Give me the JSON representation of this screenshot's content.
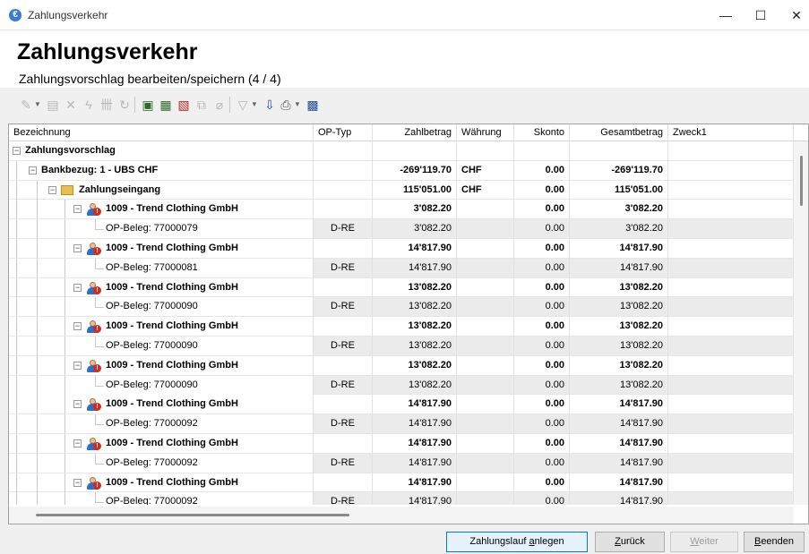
{
  "window": {
    "title": "Zahlungsverkehr",
    "minimize": "—",
    "maximize": "☐",
    "close": "✕"
  },
  "header": {
    "title": "Zahlungsverkehr",
    "subtitle": "Zahlungsvorschlag bearbeiten/speichern (4 / 4)"
  },
  "columns": [
    "Bezeichnung",
    "OP-Typ",
    "Zahlbetrag",
    "Währung",
    "Skonto",
    "Gesamtbetrag",
    "Zweck1"
  ],
  "rows": [
    {
      "name": "Zahlungsvorschlag",
      "type": "",
      "amount": "",
      "currency": "",
      "discount": "",
      "total": "",
      "purpose": ""
    },
    {
      "name": "Bankbezug: 1 - UBS CHF",
      "type": "",
      "amount": "-269'119.70",
      "currency": "CHF",
      "discount": "0.00",
      "total": "-269'119.70",
      "purpose": ""
    },
    {
      "name": "Zahlungseingang",
      "type": "",
      "amount": "115'051.00",
      "currency": "CHF",
      "discount": "0.00",
      "total": "115'051.00",
      "purpose": ""
    },
    {
      "name": "1009 - Trend Clothing GmbH",
      "type": "",
      "amount": "3'082.20",
      "currency": "",
      "discount": "0.00",
      "total": "3'082.20",
      "purpose": ""
    },
    {
      "name": "OP-Beleg: 77000079",
      "type": "D-RE",
      "amount": "3'082.20",
      "currency": "",
      "discount": "0.00",
      "total": "3'082.20",
      "purpose": ""
    },
    {
      "name": "1009 - Trend Clothing GmbH",
      "type": "",
      "amount": "14'817.90",
      "currency": "",
      "discount": "0.00",
      "total": "14'817.90",
      "purpose": ""
    },
    {
      "name": "OP-Beleg: 77000081",
      "type": "D-RE",
      "amount": "14'817.90",
      "currency": "",
      "discount": "0.00",
      "total": "14'817.90",
      "purpose": ""
    },
    {
      "name": "1009 - Trend Clothing GmbH",
      "type": "",
      "amount": "13'082.20",
      "currency": "",
      "discount": "0.00",
      "total": "13'082.20",
      "purpose": ""
    },
    {
      "name": "OP-Beleg: 77000090",
      "type": "D-RE",
      "amount": "13'082.20",
      "currency": "",
      "discount": "0.00",
      "total": "13'082.20",
      "purpose": ""
    },
    {
      "name": "1009 - Trend Clothing GmbH",
      "type": "",
      "amount": "13'082.20",
      "currency": "",
      "discount": "0.00",
      "total": "13'082.20",
      "purpose": ""
    },
    {
      "name": "OP-Beleg: 77000090",
      "type": "D-RE",
      "amount": "13'082.20",
      "currency": "",
      "discount": "0.00",
      "total": "13'082.20",
      "purpose": ""
    },
    {
      "name": "1009 - Trend Clothing GmbH",
      "type": "",
      "amount": "13'082.20",
      "currency": "",
      "discount": "0.00",
      "total": "13'082.20",
      "purpose": ""
    },
    {
      "name": "OP-Beleg: 77000090",
      "type": "D-RE",
      "amount": "13'082.20",
      "currency": "",
      "discount": "0.00",
      "total": "13'082.20",
      "purpose": ""
    },
    {
      "name": "1009 - Trend Clothing GmbH",
      "type": "",
      "amount": "14'817.90",
      "currency": "",
      "discount": "0.00",
      "total": "14'817.90",
      "purpose": ""
    },
    {
      "name": "OP-Beleg: 77000092",
      "type": "D-RE",
      "amount": "14'817.90",
      "currency": "",
      "discount": "0.00",
      "total": "14'817.90",
      "purpose": ""
    },
    {
      "name": "1009 - Trend Clothing GmbH",
      "type": "",
      "amount": "14'817.90",
      "currency": "",
      "discount": "0.00",
      "total": "14'817.90",
      "purpose": ""
    },
    {
      "name": "OP-Beleg: 77000092",
      "type": "D-RE",
      "amount": "14'817.90",
      "currency": "",
      "discount": "0.00",
      "total": "14'817.90",
      "purpose": ""
    },
    {
      "name": "1009 - Trend Clothing GmbH",
      "type": "",
      "amount": "14'817.90",
      "currency": "",
      "discount": "0.00",
      "total": "14'817.90",
      "purpose": ""
    },
    {
      "name": "OP-Beleg: 77000092",
      "type": "D-RE",
      "amount": "14'817.90",
      "currency": "",
      "discount": "0.00",
      "total": "14'817.90",
      "purpose": ""
    }
  ],
  "footer": {
    "create_run_pre": "Zahlungslauf ",
    "create_run_u": "a",
    "create_run_post": "nlegen",
    "back_u": "Z",
    "back_post": "urück",
    "next_u": "W",
    "next_post": "eiter",
    "quit_u": "B",
    "quit_post": "eenden"
  }
}
